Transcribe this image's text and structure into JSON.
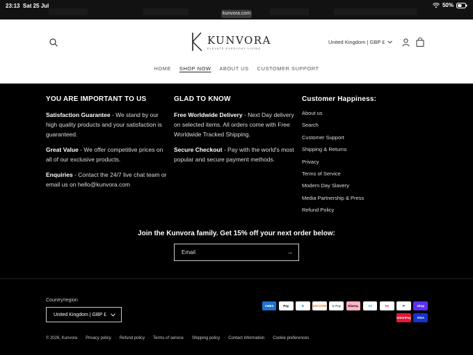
{
  "status_bar": {
    "time": "23:13",
    "date": "Sat 25 Jul",
    "url": "kunvora.com",
    "battery": "50%"
  },
  "header": {
    "logo_name": "KUNVORA",
    "logo_tagline": "ELEVATE EVERYDAY LIVING",
    "region": "United Kingdom | GBP £",
    "nav": [
      "HOME",
      "SHOP NOW",
      "ABOUT US",
      "CUSTOMER SUPPORT"
    ],
    "active_nav": "SHOP NOW"
  },
  "footer": {
    "col1": {
      "title": "YOU ARE IMPORTANT TO US",
      "items": [
        {
          "heading": "Satisfaction Guarantee",
          "text": " - We stand by our high quality products and your satisfaction is guaranteed."
        },
        {
          "heading": "Great Value",
          "text": " - We offer competitive prices on all of our exclusive products."
        },
        {
          "heading": "Enquiries",
          "text": " - Contact the 24/7 live chat team or email us on hello@kunvora.com"
        }
      ]
    },
    "col2": {
      "title": "GLAD TO KNOW",
      "items": [
        {
          "heading": "Free Worldwide Delivery",
          "text": " - Next Day delivery on selected items. All orders come with Free Worldwide Tracked Shipping."
        },
        {
          "heading": "Secure Checkout",
          "text": " - Pay with the world's most popular and secure payment methods."
        }
      ]
    },
    "col3": {
      "title": "Customer Happiness:",
      "links": [
        "About us",
        "Search",
        "Customer Support",
        "Shipping & Returns",
        "Privacy",
        "Terms of Service",
        "Modern Day Slavery",
        "Media Partnership & Press",
        "Refund Policy"
      ]
    },
    "newsletter": {
      "title": "Join the Kunvora family. Get 15% off your next order below:",
      "placeholder": "Email"
    },
    "country": {
      "label": "Country/region",
      "value": "United Kingdom | GBP £"
    },
    "payments": [
      {
        "name": "American Express",
        "label": "AMEX",
        "bg": "#1f72cd",
        "fg": "#ffffff"
      },
      {
        "name": "Apple Pay",
        "label": " Pay",
        "bg": "#ffffff",
        "fg": "#000000"
      },
      {
        "name": "Diners Club",
        "label": "D",
        "bg": "#ffffff",
        "fg": "#0079be"
      },
      {
        "name": "Discover",
        "label": "DISCOVER",
        "bg": "#ffffff",
        "fg": "#f47216"
      },
      {
        "name": "Google Pay",
        "label": "G Pay",
        "bg": "#ffffff",
        "fg": "#5f6368"
      },
      {
        "name": "Klarna",
        "label": "Klarna.",
        "bg": "#ffb3c7",
        "fg": "#000000"
      },
      {
        "name": "Maestro",
        "label": "●●",
        "bg": "#ffffff",
        "fg": "#0099df"
      },
      {
        "name": "Mastercard",
        "label": "●●",
        "bg": "#ffffff",
        "fg": "#eb001b"
      },
      {
        "name": "PayPal",
        "label": "P",
        "bg": "#ffffff",
        "fg": "#003087"
      },
      {
        "name": "Shop Pay",
        "label": "shop",
        "bg": "#5a31f4",
        "fg": "#ffffff"
      },
      {
        "name": "Union Pay",
        "label": "UnionPay",
        "bg": "#e21836",
        "fg": "#ffffff"
      },
      {
        "name": "Visa",
        "label": "VISA",
        "bg": "#1434cb",
        "fg": "#ffffff"
      }
    ],
    "legal": [
      "© 2026, Kunvora",
      "Privacy policy",
      "Refund policy",
      "Terms of service",
      "Shipping policy",
      "Contact information",
      "Cookie preferences"
    ]
  }
}
